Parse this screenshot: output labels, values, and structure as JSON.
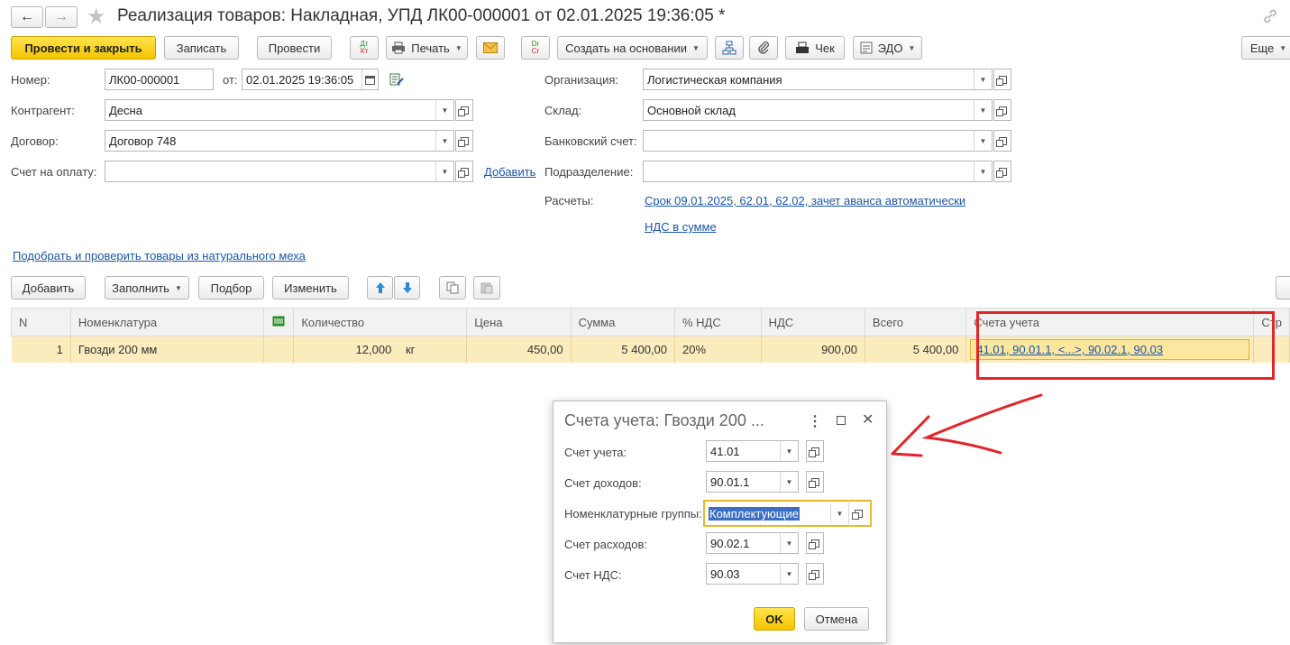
{
  "window": {
    "title": "Реализация товаров: Накладная, УПД ЛК00-000001 от 02.01.2025 19:36:05 *",
    "nav_back": "←",
    "nav_forward": "→",
    "star": "★"
  },
  "toolbar": {
    "post_close": "Провести и закрыть",
    "save": "Записать",
    "post": "Провести",
    "dtkt_top": "Дт",
    "dtkt_bottom": "Кт",
    "print": "Печать",
    "drcr_top": "Dr",
    "drcr_bottom": "Cr",
    "create_based": "Создать на основании",
    "check": "Чек",
    "edo": "ЭДО",
    "more": "Еще"
  },
  "header_fields": {
    "number_label": "Номер:",
    "number_value": "ЛК00-000001",
    "date_label": "от:",
    "date_value": "02.01.2025 19:36:05",
    "counterparty_label": "Контрагент:",
    "counterparty_value": "Десна",
    "contract_label": "Договор:",
    "contract_value": "Договор 748",
    "invoice_label": "Счет на оплату:",
    "invoice_value": "",
    "add_link": "Добавить",
    "org_label": "Организация:",
    "org_value": "Логистическая компания",
    "warehouse_label": "Склад:",
    "warehouse_value": "Основной склад",
    "bank_label": "Банковский счет:",
    "bank_value": "",
    "division_label": "Подразделение:",
    "division_value": "",
    "settlements_label": "Расчеты:",
    "settlements_link": "Срок 09.01.2025, 62.01, 62.02, зачет аванса автоматически",
    "vat_link": "НДС в сумме"
  },
  "fur_link": "Подобрать и проверить товары из натурального меха",
  "table_toolbar": {
    "add": "Добавить",
    "fill": "Заполнить",
    "selection": "Подбор",
    "change": "Изменить"
  },
  "table": {
    "columns": [
      "N",
      "Номенклатура",
      "",
      "Количество",
      "Цена",
      "Сумма",
      "% НДС",
      "НДС",
      "Всего",
      "Счета учета",
      "Стр"
    ],
    "rows": [
      {
        "n": "1",
        "item": "Гвозди 200 мм",
        "qty": "12,000",
        "unit": "кг",
        "price": "450,00",
        "sum": "5 400,00",
        "vat_rate": "20%",
        "vat": "900,00",
        "total": "5 400,00",
        "accounts": "41.01, 90.01.1, <...>, 90.02.1, 90.03"
      }
    ]
  },
  "dialog": {
    "title": "Счета учета: Гвозди 200 ...",
    "account_label": "Счет учета:",
    "account_value": "41.01",
    "income_label": "Счет доходов:",
    "income_value": "90.01.1",
    "groups_label": "Номенклатурные группы:",
    "groups_value": "Комплектующие",
    "expense_label": "Счет расходов:",
    "expense_value": "90.02.1",
    "vat_label": "Счет НДС:",
    "vat_value": "90.03",
    "ok": "OK",
    "cancel": "Отмена"
  },
  "colors": {
    "primary_button": "#f5c400",
    "link": "#1a57a4",
    "row_highlight": "#fbecbd",
    "annotation": "#e0262b"
  }
}
